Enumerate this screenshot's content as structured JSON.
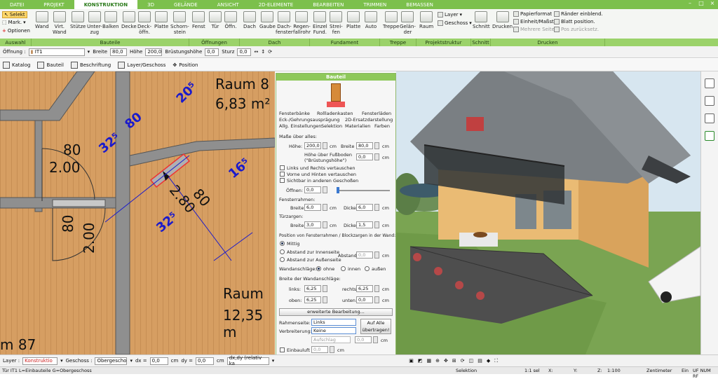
{
  "menu": [
    "DATEI",
    "PROJEKT",
    "KONSTRUKTION",
    "3D",
    "GELÄNDE",
    "ANSICHT",
    "2D-ELEMENTE",
    "BEARBEITEN",
    "TRIMMEN",
    "BEMASSEN"
  ],
  "ribbon": {
    "auswahl": {
      "selekt": "Selekt",
      "mark": "Mark.",
      "optionen": "Optionen"
    },
    "buttons": [
      {
        "l1": "Wand",
        "l2": ""
      },
      {
        "l1": "Virt.",
        "l2": "Wand"
      },
      {
        "l1": "Stütze",
        "l2": ""
      },
      {
        "l1": "Unter-",
        "l2": "zug"
      },
      {
        "l1": "Balken",
        "l2": ""
      },
      {
        "l1": "Decke",
        "l2": ""
      },
      {
        "l1": "Deck-",
        "l2": "öffn."
      },
      {
        "l1": "Platte",
        "l2": ""
      },
      {
        "l1": "Schorn-",
        "l2": "stein"
      },
      {
        "l1": "Fenst",
        "l2": ""
      },
      {
        "l1": "Tür",
        "l2": ""
      },
      {
        "l1": "Öffn.",
        "l2": ""
      },
      {
        "l1": "Dach",
        "l2": ""
      },
      {
        "l1": "Gaube",
        "l2": ""
      },
      {
        "l1": "Dach-",
        "l2": "fenster"
      },
      {
        "l1": "Regen-",
        "l2": "fallrohr"
      },
      {
        "l1": "Einzel",
        "l2": "Fund."
      },
      {
        "l1": "Strei-",
        "l2": "fen"
      },
      {
        "l1": "Platte",
        "l2": ""
      },
      {
        "l1": "Auto",
        "l2": ""
      },
      {
        "l1": "Treppe",
        "l2": ""
      },
      {
        "l1": "Gelän-",
        "l2": "der"
      },
      {
        "l1": "Raum",
        "l2": ""
      },
      {
        "l1": "Schnitt",
        "l2": ""
      },
      {
        "l1": "Drucken",
        "l2": ""
      }
    ],
    "layer": "Layer",
    "geschoss": "Geschoss",
    "print_opts": [
      "Papierformat",
      "Einheit/Maßst.",
      "Mehrere Seiten",
      "Ränder einblend.",
      "Blatt position.",
      "Pos zurücksetz."
    ],
    "groups": [
      "Auswahl",
      "Bauteile",
      "Öffnungen",
      "Dach",
      "Fundament",
      "Treppe",
      "Projektstruktur",
      "Schnitt",
      "Drucken"
    ]
  },
  "propbar": {
    "oeffnung_label": "Öffnung :",
    "oeffnung_val": "IT1",
    "breite_label": "Breite",
    "breite": "80,0",
    "hoehe_label": "Höhe",
    "hoehe": "200,0",
    "bruest_label": "Brüstungshöhe",
    "bruest": "0,0",
    "sturz_label": "Sturz",
    "sturz": "0,0"
  },
  "toolbar2": [
    "Katalog",
    "Bauteil",
    "Beschriftung",
    "Layer/Geschoss",
    "Position"
  ],
  "plan": {
    "rooms": [
      {
        "name": "Raum 8",
        "area": "6,83 m²"
      },
      {
        "name": "Raum",
        "area": "12,35 m"
      },
      {
        "frag": "m 87"
      }
    ],
    "door1": {
      "w": "80",
      "h": "2.00"
    },
    "door2": {
      "w": "80",
      "h": "2.00"
    },
    "dims": {
      "d205": "20⁵",
      "d80": "80",
      "d325a": "32⁵",
      "d165": "16⁵",
      "d280": "2.80",
      "d80b": "80",
      "d325b": "32⁵"
    }
  },
  "dialog": {
    "title": "Bauteil",
    "tabs1": [
      "Fensterbänke",
      "Rollladenkasten",
      "Fensterläden"
    ],
    "tabs2": [
      "Eck-/Gehrungsausprägung",
      "2D-Ersatzdarstellung"
    ],
    "tabs3": [
      "Allg. Einstellungen",
      "Selektion",
      "Materialien",
      "Farben"
    ],
    "masse_label": "Maße über alles:",
    "hoehe_label": "Höhe:",
    "hoehe": "200,0",
    "breite_label": "Breite",
    "breite": "80,0",
    "unit": "cm",
    "fuss_label1": "Höhe über Fußboden",
    "fuss_label2": "(\"Brüstungshöhe\")",
    "fuss": "0,0",
    "checks": [
      "Links und Rechts vertauschen",
      "Vorne und Hinten vertauschen",
      "Sichtbar in anderen Geschoßen"
    ],
    "oeffnen_label": "Öffnen:",
    "oeffnen": "0,0",
    "fenster_label": "Fensterrahmen:",
    "fr_breite_label": "Breite:",
    "fr_breite": "6,0",
    "fr_dicke_label": "Dicke:",
    "fr_dicke": "6,0",
    "tuer_label": "Türzargen:",
    "tz_breite_label": "Breite:",
    "tz_breite": "3,0",
    "tz_dicke_label": "Dicke:",
    "tz_dicke": "1,5",
    "pos_label": "Position von Fensterrahmen / Blockzargen in der Wand:",
    "pos_opts": [
      "Mittig",
      "Abstand zur Innenseite",
      "Abstand zur Außenseite"
    ],
    "abstand_label": "Abstand",
    "abstand": "0,0",
    "wand_label": "Wandanschläge:",
    "wand_opts": [
      "ohne",
      "innen",
      "außen"
    ],
    "breite_wand_label": "Breite der Wandanschläge:",
    "links_label": "links:",
    "links": "6,25",
    "rechts_label": "rechts:",
    "rechts": "6,25",
    "oben_label": "oben:",
    "oben": "6,25",
    "unten_label": "unten:",
    "unten": "0,0",
    "erweitert": "erweiterte Bearbeitung...",
    "rahmen_label": "Rahmenseite:",
    "rahmen": "Links",
    "verbr_label": "Verbreiterung:",
    "verbr": "Keine",
    "aufschlag": "Aufschlag",
    "aufschlag_val": "0,0",
    "auf_alle": "Auf Alle übertragen!",
    "einbau_label": "Einbauluft",
    "einbau": "0,0"
  },
  "bottombar": {
    "layer_label": "Layer :",
    "layer": "Konstruktio",
    "geschoss_label": "Geschoss :",
    "geschoss": "Obergescho",
    "dx_label": "dx =",
    "dx": "0,0",
    "dy_label": "dy =",
    "dy": "0,0",
    "unit": "cm",
    "mode": "dx,dy (relativ ka"
  },
  "status": {
    "left": "Tür IT1 L=Einbauteile G=Obergeschoss",
    "selektion": "Selektion",
    "scale": "1:1 sel",
    "x": "X:",
    "y": "Y:",
    "z": "Z:",
    "ratio": "1:100",
    "unit": "Zentimeter",
    "ein": "Ein",
    "flags": "UF NUM RF"
  },
  "colors": {
    "green": "#7cc04c",
    "plan_floor": "#d69e62",
    "wall": "#8f8f8f",
    "dim": "#1a1acc"
  }
}
